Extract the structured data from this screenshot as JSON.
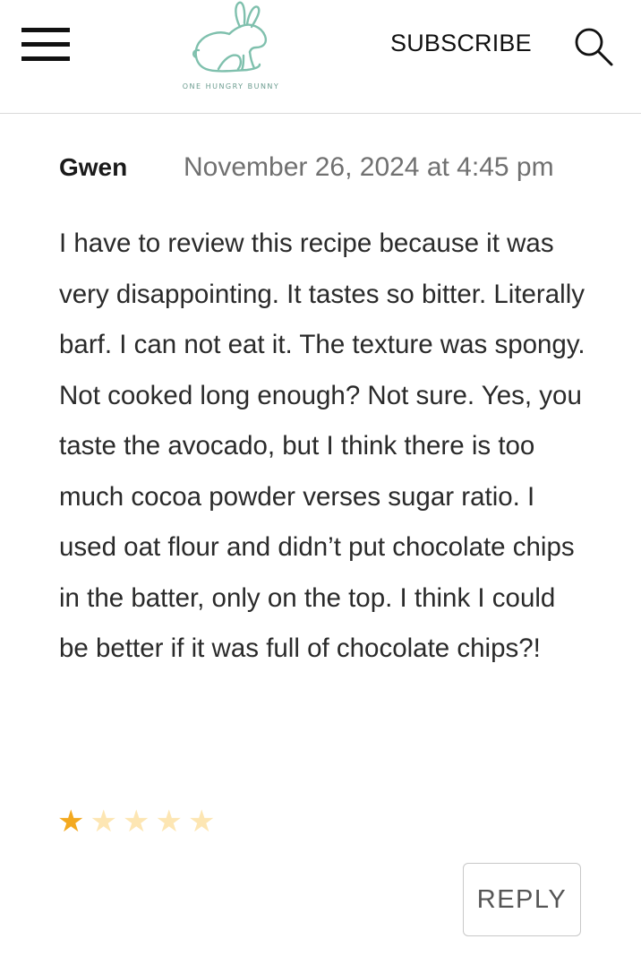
{
  "header": {
    "logo_text": "ONE HUNGRY BUNNY",
    "subscribe_label": "SUBSCRIBE",
    "icons": {
      "menu": "hamburger-menu-icon",
      "search": "search-icon",
      "logo": "bunny-logo-icon"
    },
    "logo_color": "#7fc0ad"
  },
  "comment": {
    "author": "Gwen",
    "date": "November 26, 2024 at 4:45 pm",
    "text": "I have to review this recipe because it was very disappointing. It tastes so bitter. Literally barf. I can not eat it. The texture was spongy. Not cooked long enough? Not sure. Yes, you taste the avocado, but I think there is too much cocoa powder verses sugar ratio. I used oat flour and didn’t put chocolate chips in the batter, only on the top. I think I could be better if it was full of chocolate chips?!",
    "rating": 1,
    "rating_max": 5,
    "star_color": "#f3a920",
    "star_empty_color": "#fde6b3",
    "reply_label": "REPLY"
  }
}
